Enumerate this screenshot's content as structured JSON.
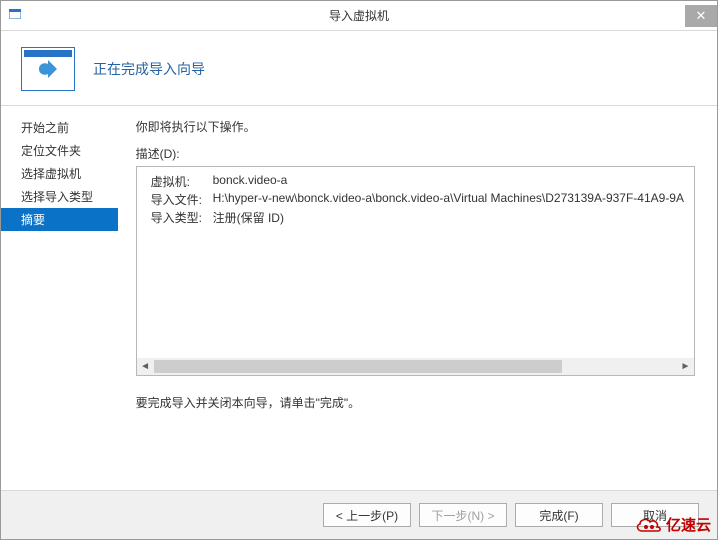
{
  "titlebar": {
    "text": "导入虚拟机",
    "close": "✕"
  },
  "header": {
    "title": "正在完成导入向导"
  },
  "sidebar": {
    "items": [
      {
        "label": "开始之前"
      },
      {
        "label": "定位文件夹"
      },
      {
        "label": "选择虚拟机"
      },
      {
        "label": "选择导入类型"
      },
      {
        "label": "摘要"
      }
    ],
    "active_index": 4
  },
  "main": {
    "intro": "你即将执行以下操作。",
    "desc_label": "描述(D):",
    "rows": [
      {
        "key": "虚拟机:",
        "val": "bonck.video-a"
      },
      {
        "key": "导入文件:",
        "val": "H:\\hyper-v-new\\bonck.video-a\\bonck.video-a\\Virtual Machines\\D273139A-937F-41A9-9A"
      },
      {
        "key": "导入类型:",
        "val": "注册(保留 ID)"
      }
    ],
    "outro": "要完成导入并关闭本向导，请单击\"完成\"。"
  },
  "buttons": {
    "prev": "< 上一步(P)",
    "next": "下一步(N) >",
    "finish": "完成(F)",
    "cancel": "取消"
  },
  "watermark": {
    "text": "亿速云"
  }
}
